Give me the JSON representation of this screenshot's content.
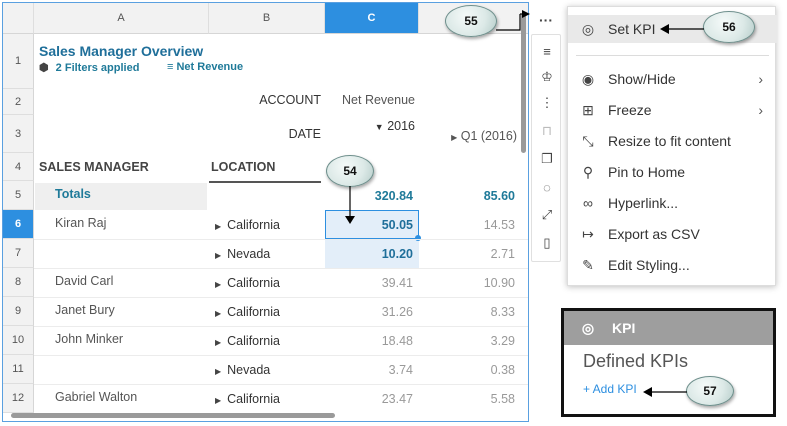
{
  "sheet": {
    "columns": [
      "A",
      "B",
      "C"
    ],
    "rows": [
      "1",
      "2",
      "3",
      "4",
      "5",
      "6",
      "7",
      "8",
      "9",
      "10",
      "11",
      "12"
    ],
    "title": "Sales Manager Overview",
    "filters": "2 Filters applied",
    "measure": "Net Revenue",
    "account_label": "ACCOUNT",
    "account_value": "Net Revenue",
    "date_label": "DATE",
    "date_value": "2016",
    "date_next": "Q1 (2016)",
    "col_sales_manager": "SALES MANAGER",
    "col_location": "LOCATION",
    "totals_label": "Totals",
    "totals_c": "320.84",
    "totals_d": "85.60",
    "data_rows": [
      {
        "manager": "Kiran Raj",
        "location": "California",
        "c": "50.05",
        "d": "14.53"
      },
      {
        "manager": "",
        "location": "Nevada",
        "c": "10.20",
        "d": "2.71"
      },
      {
        "manager": "David Carl",
        "location": "California",
        "c": "39.41",
        "d": "10.90"
      },
      {
        "manager": "Janet Bury",
        "location": "California",
        "c": "31.26",
        "d": "8.33"
      },
      {
        "manager": "John Minker",
        "location": "California",
        "c": "18.48",
        "d": "3.29"
      },
      {
        "manager": "",
        "location": "Nevada",
        "c": "3.74",
        "d": "0.38"
      },
      {
        "manager": "Gabriel Walton",
        "location": "California",
        "c": "23.47",
        "d": "5.58"
      }
    ]
  },
  "toolbar": {
    "more": "···",
    "icons": [
      "sort-icon",
      "trophy-icon",
      "hierarchy-icon",
      "lock-icon",
      "copy-icon",
      "comment-icon",
      "fullscreen-icon",
      "trash-icon"
    ]
  },
  "menu": {
    "items": [
      {
        "label": "Set KPI",
        "icon": "target-icon"
      },
      {
        "label": "Show/Hide",
        "icon": "eye-icon"
      },
      {
        "label": "Freeze",
        "icon": "freeze-icon"
      },
      {
        "label": "Resize to fit content",
        "icon": "resize-icon"
      },
      {
        "label": "Pin to Home",
        "icon": "pin-icon"
      },
      {
        "label": "Hyperlink...",
        "icon": "link-icon"
      },
      {
        "label": "Export as CSV",
        "icon": "export-icon"
      },
      {
        "label": "Edit Styling...",
        "icon": "paint-icon"
      }
    ]
  },
  "kpi_panel": {
    "title": "KPI",
    "defined": "Defined KPIs",
    "add": "+ Add KPI"
  },
  "callouts": [
    "54",
    "55",
    "56",
    "57"
  ]
}
